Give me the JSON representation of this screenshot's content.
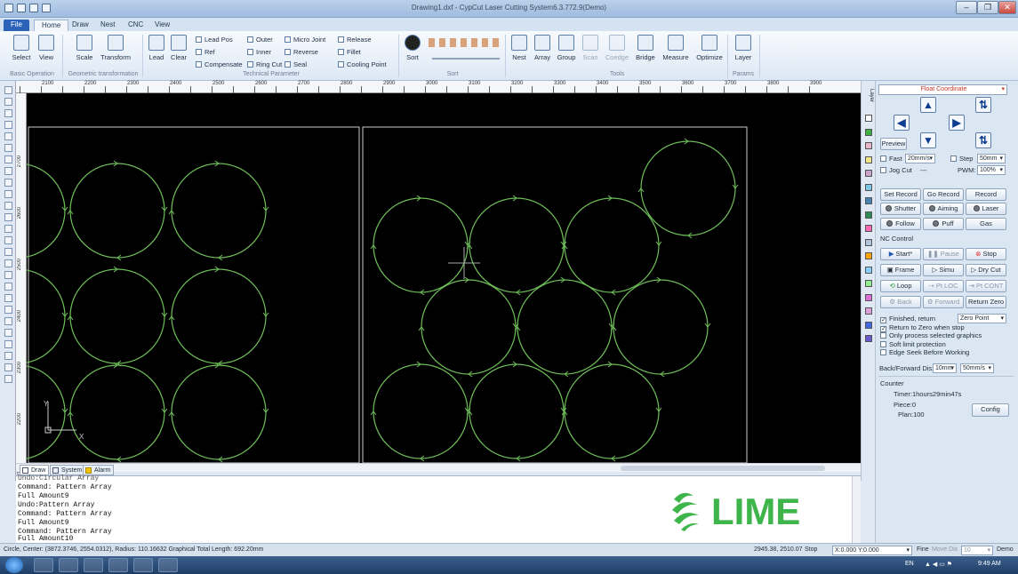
{
  "window": {
    "title": "Drawing1.dxf - CypCut Laser Cutting System6.3.772.9(Demo)",
    "minimize": "‒",
    "restore": "❐",
    "close": "✕"
  },
  "tabs": [
    "File",
    "Home",
    "Draw",
    "Nest",
    "CNC",
    "View"
  ],
  "ribbon": {
    "basic": {
      "select": "Select",
      "view": "View",
      "group": "Basic Operation"
    },
    "geo": {
      "scale": "Scale",
      "transform": "Transform",
      "group": "Geometric transformation"
    },
    "tech": {
      "lead": "Lead",
      "clear": "Clear",
      "lead_pos": "Lead Pos",
      "ref": "Ref",
      "compensate": "Compensate",
      "outer": "Outer",
      "inner": "Inner",
      "ring_cut": "Ring Cut",
      "micro_joint": "Micro Joint",
      "reverse": "Reverse",
      "seal": "Seal",
      "release": "Release",
      "fillet": "Fillet",
      "cooling_point": "Cooling Point",
      "group": "Technical Parameter"
    },
    "sort": {
      "sort": "Sort",
      "group": "Sort"
    },
    "tools": {
      "nest": "Nest",
      "array": "Array",
      "group_btn": "Group",
      "scan": "Scan",
      "coedge": "Coedge",
      "bridge": "Bridge",
      "measure": "Measure",
      "optimize": "Optimize",
      "group": "Tools"
    },
    "params": {
      "layer": "Layer",
      "group": "Params"
    }
  },
  "ruler_x": [
    "2050",
    "2100",
    "2150",
    "2200",
    "2250",
    "2300",
    "2350",
    "2400",
    "2450",
    "2500",
    "2550",
    "2600",
    "2650",
    "2700",
    "2750",
    "2800",
    "2850",
    "2900",
    "2950",
    "3000",
    "3050",
    "3100",
    "3150",
    "3200",
    "3250",
    "3300",
    "3350",
    "3400",
    "3450",
    "3500",
    "3550",
    "3600",
    "3650",
    "3700",
    "3750",
    "3800",
    "3850",
    "3900"
  ],
  "ruler_y": [
    "2700",
    "2600",
    "2500",
    "2400",
    "2300",
    "2200",
    "2100"
  ],
  "axis": {
    "x": "X",
    "y": "Y"
  },
  "canvas_tabs": [
    "Draw",
    "System",
    "Alarm"
  ],
  "side_tab": "Layer",
  "layer_colors": [
    "#ffffff",
    "#3cb043",
    "#e9b6c9",
    "#f0e68c",
    "#c8a2c8",
    "#7ec8e3",
    "#4682b4",
    "#2e8b57",
    "#ff69b4",
    "#b0c4de",
    "#ffa500",
    "#87cefa",
    "#90ee90",
    "#da70d6",
    "#dda0dd",
    "#4169e1",
    "#6a5acd"
  ],
  "panel": {
    "coordinate": "Float Coordinate",
    "preview": "Preview",
    "fast": "Fast",
    "fast_speed": "20mm/s",
    "step": "Step",
    "step_val": "50mm",
    "jog_cut": "Jog Cut",
    "jog_val": "---",
    "pwm": "PWM:",
    "pwm_val": "100%",
    "set_record": "Set Record",
    "go_record": "Go Record",
    "record": "Record",
    "shutter": "Shutter",
    "aiming": "Aiming",
    "laser": "Laser",
    "follow": "Follow",
    "puff": "Puff",
    "gas": "Gas",
    "nc_control": "NC Control",
    "start": "Start*",
    "pause": "Pause",
    "stop": "Stop",
    "frame": "Frame",
    "simu": "Simu",
    "dry_cut": "Dry Cut",
    "loop": "Loop",
    "pt_loc": "Pt LOC",
    "pt_cont": "Pt CONT",
    "back": "Back",
    "forward": "Forward",
    "return_zero": "Return Zero",
    "finished_return": "Finished, return",
    "zero_point": "Zero Point",
    "return_to_zero": "Return to Zero when stop",
    "only_selected": "Only process selected graphics",
    "soft_limit": "Soft limit protection",
    "edge_seek": "Edge Seek Before Working",
    "back_forward": "Back/Forward Dis:",
    "bf_dist": "10mm",
    "bf_speed": "50mm/s",
    "counter": "Counter",
    "timer": "Timer:1hours29min47s",
    "piece": "Piece:0",
    "plan": "Plan:100",
    "config": "Config"
  },
  "console": [
    "Undo:Circular Array",
    "Command: Pattern Array",
    "Full Amount9",
    "Undo:Pattern Array",
    "Command: Pattern Array",
    "Full Amount9",
    "Command: Pattern Array",
    "Full Amount10"
  ],
  "logo": {
    "text": "LIME",
    "color": "#3db54a"
  },
  "status": {
    "info": "Circle, Center: (3872.3746, 2554.0312), Radius: 110.16632 Graphical Total Length: 692.20mm",
    "coords": "2945.38, 2510.07",
    "state": "Stop",
    "pos": "X:0.000 Y:0.000",
    "fine": "Fine",
    "move_dis": "Move Dis",
    "move_val": "10",
    "mode": "Demo"
  },
  "taskbar": {
    "lang": "EN",
    "time": "9:49 AM"
  }
}
